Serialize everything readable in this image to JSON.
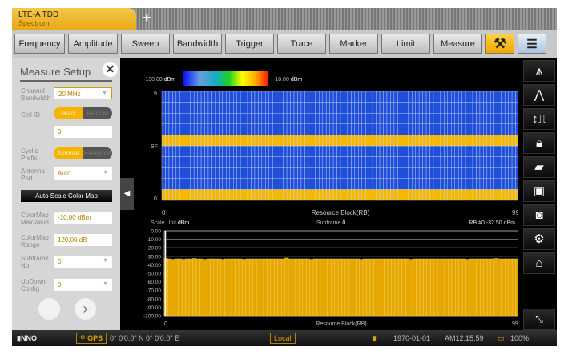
{
  "tab": {
    "title": "LTE-A TDD",
    "subtitle": "Spectrum",
    "add": "+"
  },
  "toolbar": [
    "Frequency",
    "Amplitude",
    "Sweep",
    "Bandwidth",
    "Trigger",
    "Trace",
    "Marker",
    "Limit",
    "Measure"
  ],
  "panel": {
    "title": "Measure Setup",
    "channel_bw_label": "Channel Bandwidth",
    "channel_bw": "20 MHz",
    "cell_id_label": "Cell ID",
    "cell_id_mode": [
      "Auto",
      "Manual"
    ],
    "cell_id": "0",
    "cyclic_label": "Cyclic Prefix",
    "cyclic_mode": [
      "Normal",
      "Extended"
    ],
    "antenna_label": "Antenna Port",
    "antenna": "Auto",
    "auto_scale": "Auto Scale Color Map",
    "cmax_label": "ColorMap MaxValue",
    "cmax": "-10.00 dBm",
    "crange_label": "ColorMap Range",
    "crange": "120.00 dB",
    "subframe_label": "Subframe No",
    "subframe": "0",
    "updown_label": "UpDown Config",
    "updown": "0",
    "next": "›"
  },
  "chart_data": [
    {
      "type": "heatmap",
      "colorbar_min": "-130.00",
      "colorbar_max": "-10.00",
      "unit": "dBm",
      "ylabel": "SF",
      "xlabel": "Resource Block(RB)",
      "x_ticks": [
        "0",
        "99"
      ],
      "y_ticks": [
        "0",
        "9"
      ],
      "rows": 10,
      "cols": 100,
      "active_subframes": [
        0,
        5
      ],
      "colors": {
        "active": "#f5b800",
        "inactive": "#1f4fd8"
      }
    },
    {
      "type": "bar",
      "scale_unit_label": "Scale Unit",
      "scale_unit": "dBm",
      "subframe_label": "Subframe",
      "subframe": "0",
      "marker": "RB #0,-32.50 dBm",
      "xlabel": "Resource Block(RB)",
      "x_ticks": [
        "0",
        "99"
      ],
      "y_ticks": [
        "0.00",
        "-10.00",
        "-20.00",
        "-30.00",
        "-40.00",
        "-50.00",
        "-60.00",
        "-70.00",
        "-80.00",
        "-90.00",
        "-100.00"
      ],
      "ylim": [
        -100,
        0
      ],
      "bar_color": "#e6a800",
      "values": [
        -32.5,
        -33,
        -33.5,
        -33,
        -33,
        -33.5,
        -33,
        -33,
        -32.5,
        -33,
        -33,
        -33.5,
        -33,
        -33,
        -33,
        -33,
        -33.5,
        -33,
        -33,
        -33,
        -33,
        -33,
        -33.5,
        -33,
        -33,
        -33,
        -33,
        -33,
        -33,
        -33,
        -33,
        -33,
        -33,
        -33,
        -32,
        -33,
        -33,
        -33,
        -33,
        -33,
        -33,
        -33.5,
        -33,
        -33,
        -33,
        -33,
        -33,
        -33,
        -33,
        -33,
        -33,
        -33,
        -33,
        -33,
        -33,
        -33.5,
        -33,
        -33,
        -33,
        -33,
        -33,
        -33,
        -33,
        -33,
        -33,
        -33,
        -33,
        -33,
        -33,
        -33.5,
        -33,
        -33,
        -33,
        -33,
        -33,
        -33,
        -33,
        -33,
        -33,
        -33,
        -33,
        -33,
        -33,
        -33,
        -33,
        -33.5,
        -33,
        -33,
        -33,
        -33,
        -33,
        -33,
        -33,
        -32.5,
        -33,
        -33,
        -33,
        -33,
        -33,
        -33
      ]
    }
  ],
  "status": {
    "gps": "GPS",
    "coords": "0° 0'0.0\" N 0° 0'0.0\" E",
    "local": "Local",
    "date": "1970-01-01",
    "time": "AM12:15:59",
    "battery": "100%"
  }
}
